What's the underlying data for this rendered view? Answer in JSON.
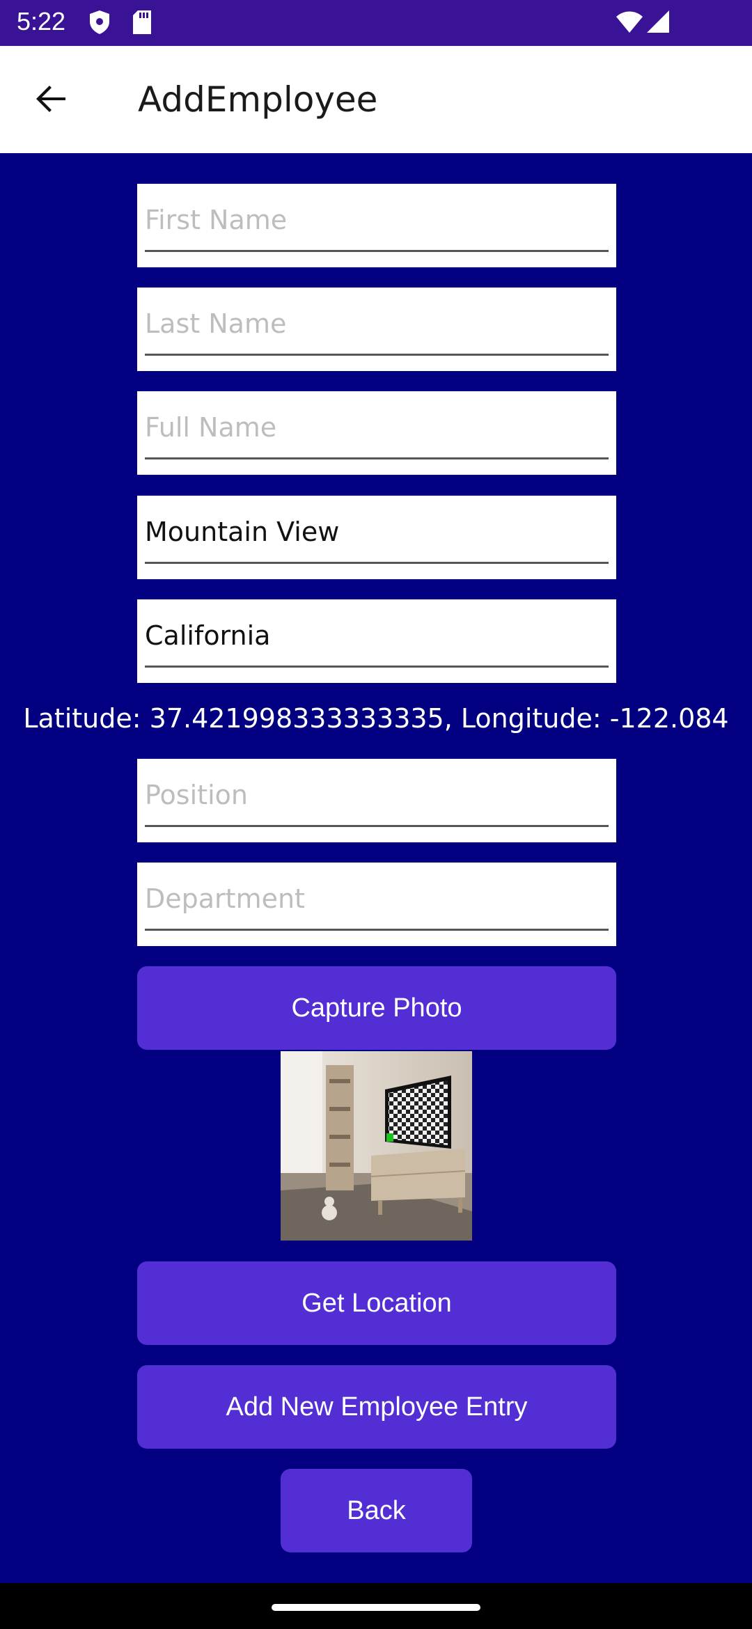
{
  "status_bar": {
    "time": "5:22",
    "icons": [
      "shield-icon",
      "sd-card-icon",
      "wifi-icon",
      "signal-icon"
    ]
  },
  "app_bar": {
    "title": "AddEmployee",
    "back_icon": "arrow-back-icon"
  },
  "form": {
    "first_name": {
      "value": "",
      "placeholder": "First Name"
    },
    "last_name": {
      "value": "",
      "placeholder": "Last Name"
    },
    "full_name": {
      "value": "",
      "placeholder": "Full Name"
    },
    "city": {
      "value": "Mountain View",
      "placeholder": ""
    },
    "state": {
      "value": "California",
      "placeholder": ""
    },
    "location_text": "Latitude: 37.421998333333335, Longitude: -122.084",
    "position": {
      "value": "",
      "placeholder": "Position"
    },
    "department": {
      "value": "",
      "placeholder": "Department"
    }
  },
  "buttons": {
    "capture_photo": "Capture Photo",
    "get_location": "Get Location",
    "add_entry": "Add New Employee Entry",
    "back": "Back"
  },
  "colors": {
    "background": "#020080",
    "status_bar": "#3a1296",
    "button": "#522ed4",
    "app_bar": "#ffffff"
  }
}
